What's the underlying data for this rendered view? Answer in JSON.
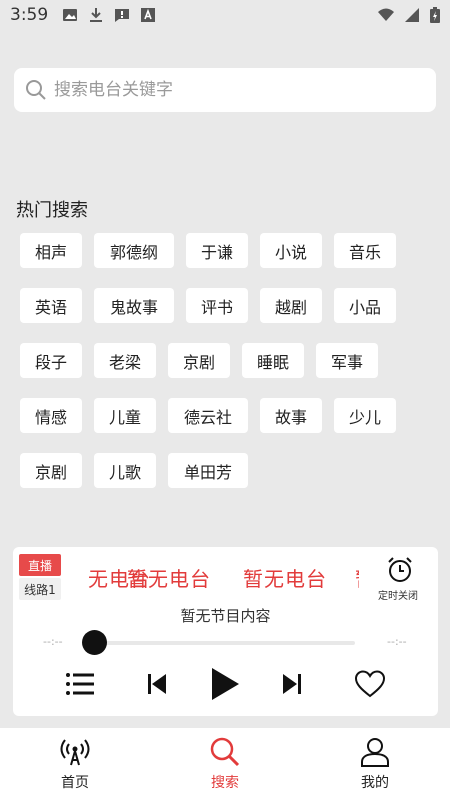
{
  "status_bar": {
    "time": "3:59",
    "left_icons": [
      "image-icon",
      "download-icon",
      "alert-icon",
      "font-icon"
    ],
    "right_icons": [
      "wifi-icon",
      "signal-icon",
      "battery-icon"
    ]
  },
  "search": {
    "placeholder": "搜索电台关键字"
  },
  "hot_search": {
    "title": "热门搜索",
    "rows": [
      [
        "相声",
        "郭德纲",
        "于谦",
        "小说",
        "音乐"
      ],
      [
        "英语",
        "鬼故事",
        "评书",
        "越剧",
        "小品"
      ],
      [
        "段子",
        "老梁",
        "京剧",
        "睡眠",
        "军事"
      ],
      [
        "情感",
        "儿童",
        "德云社",
        "故事",
        "少儿"
      ],
      [
        "京剧",
        "儿歌",
        "单田芳"
      ]
    ]
  },
  "player": {
    "live_label": "直播",
    "line_label": "线路1",
    "marquee_text": "暂无电台",
    "timer_label": "定时关闭",
    "program_text": "暂无节目内容",
    "time_elapsed": "--:--",
    "time_total": "--:--",
    "progress": 0
  },
  "bottom_nav": [
    {
      "label": "首页",
      "icon": "radio-tower-icon",
      "active": false
    },
    {
      "label": "搜索",
      "icon": "search-icon",
      "active": true
    },
    {
      "label": "我的",
      "icon": "user-icon",
      "active": false
    }
  ],
  "colors": {
    "accent": "#e23b3b",
    "live_badge": "#e74a4a",
    "background": "#e9e9e9"
  }
}
